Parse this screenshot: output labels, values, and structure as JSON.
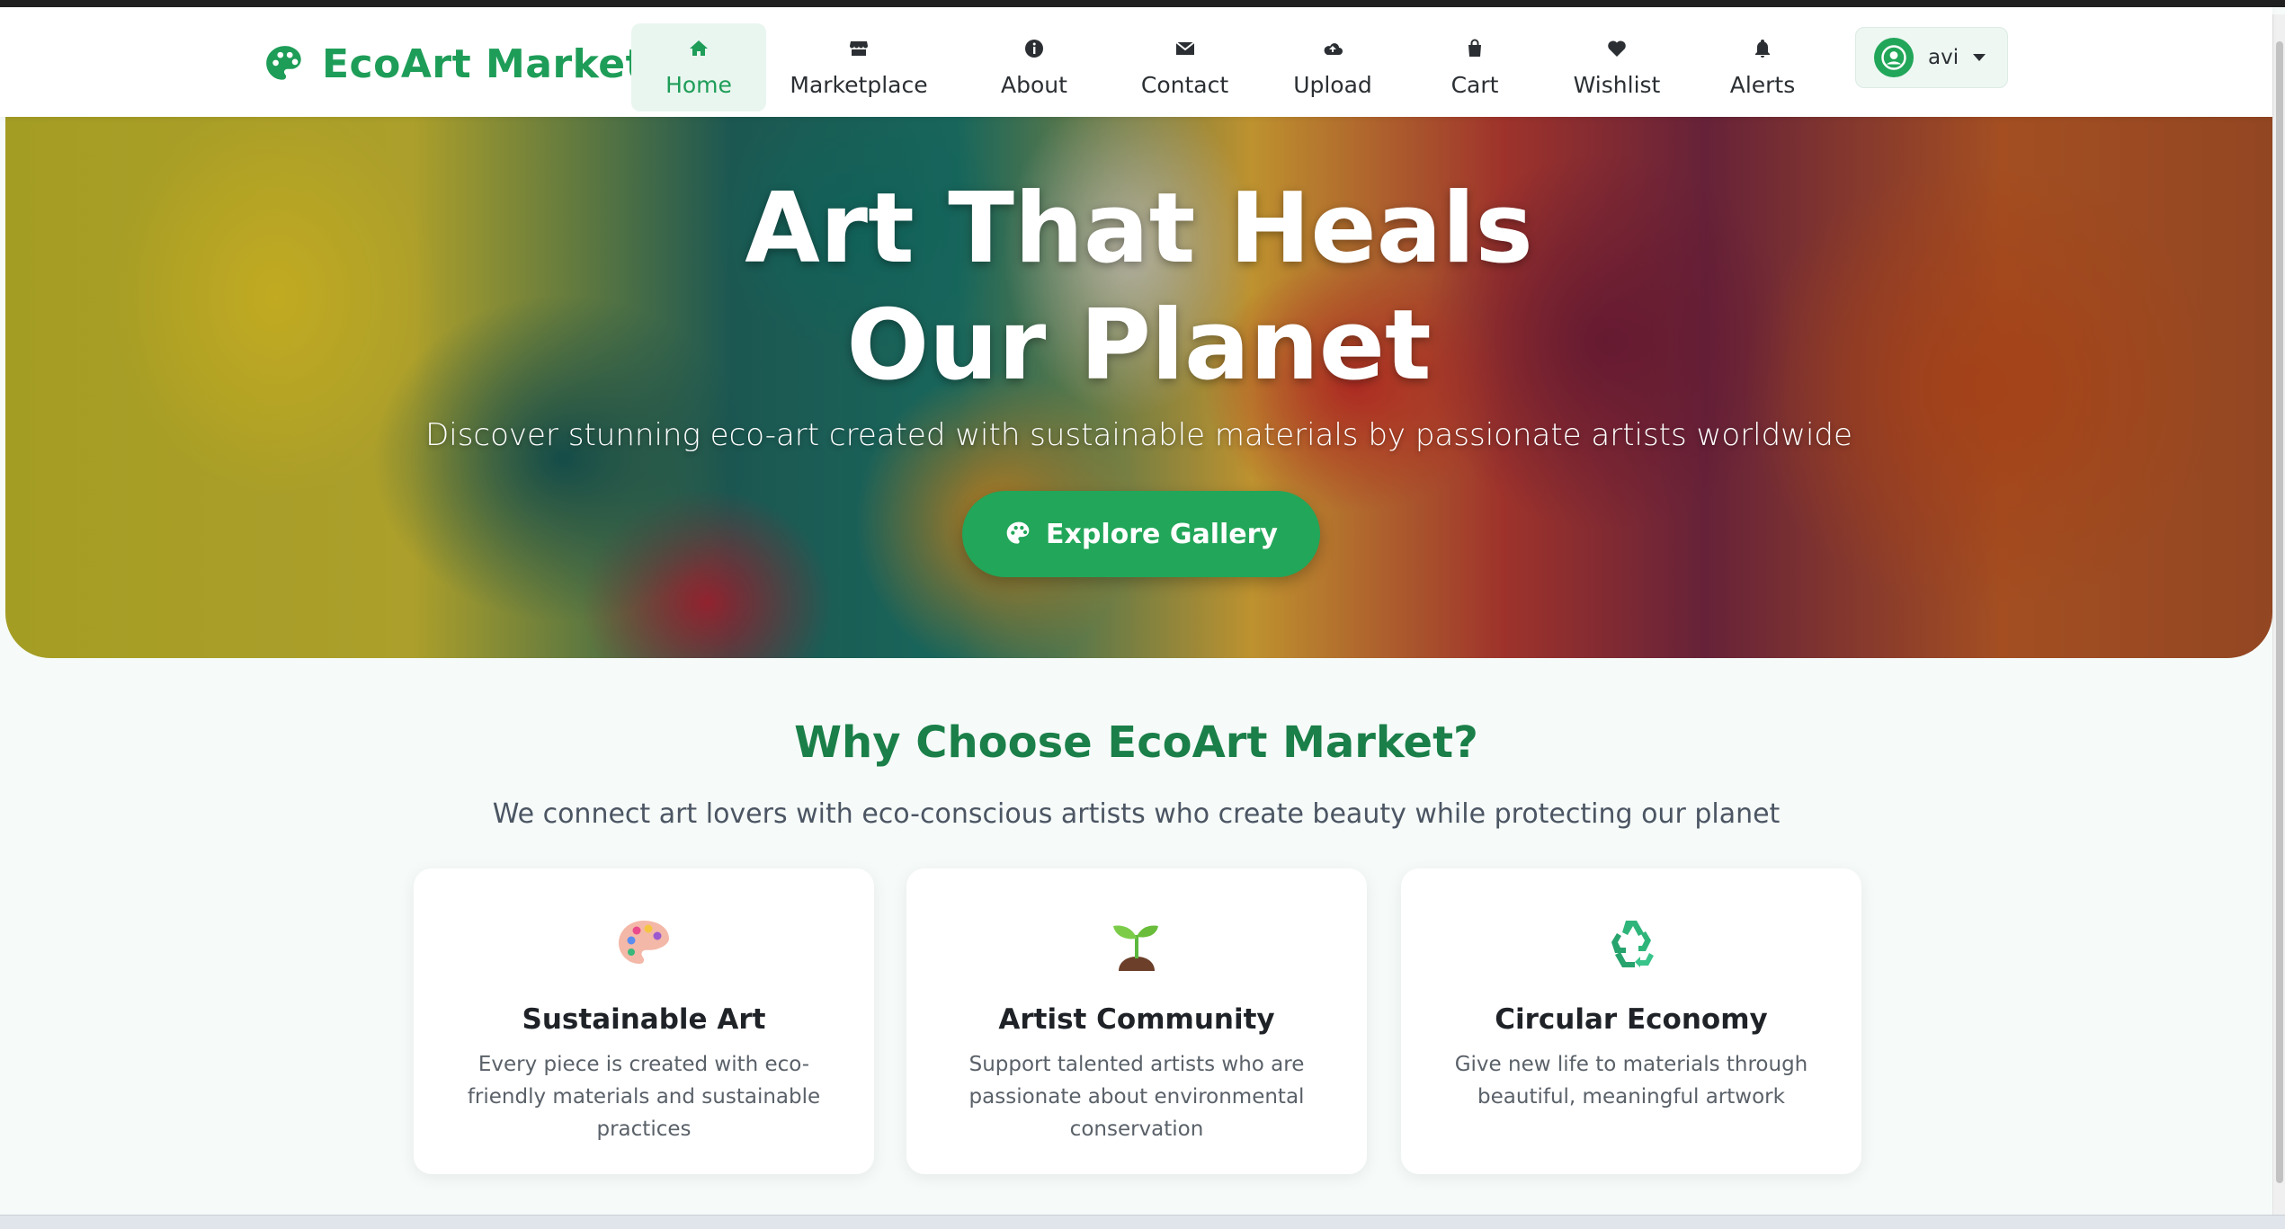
{
  "brand": {
    "name": "EcoArt Market",
    "icon": "palette-icon",
    "color": "#1e9d58"
  },
  "nav": {
    "items": [
      {
        "label": "Home",
        "icon": "home-icon",
        "active": true
      },
      {
        "label": "Marketplace",
        "icon": "store-icon"
      },
      {
        "label": "About",
        "icon": "info-icon"
      },
      {
        "label": "Contact",
        "icon": "envelope-icon"
      },
      {
        "label": "Upload",
        "icon": "cloud-upload-icon"
      },
      {
        "label": "Cart",
        "icon": "bag-icon"
      },
      {
        "label": "Wishlist",
        "icon": "heart-icon"
      },
      {
        "label": "Alerts",
        "icon": "bell-icon"
      }
    ],
    "user": {
      "name": "avi",
      "icon": "user-circle-icon"
    }
  },
  "hero": {
    "title_line1": "Art That Heals",
    "title_line2": "Our Planet",
    "subtitle": "Discover stunning eco-art created with sustainable materials by passionate artists worldwide",
    "button": "Explore Gallery"
  },
  "why": {
    "title": "Why Choose EcoArt Market?",
    "subtitle": "We connect art lovers with eco-conscious artists who create beauty while protecting our planet",
    "cards": [
      {
        "icon": "artist-palette-icon",
        "title": "Sustainable Art",
        "text": "Every piece is created with eco-friendly materials and sustainable practices"
      },
      {
        "icon": "seedling-icon",
        "title": "Artist Community",
        "text": "Support talented artists who are passionate about environmental conservation"
      },
      {
        "icon": "recycle-icon",
        "title": "Circular Economy",
        "text": "Give new life to materials through beautiful, meaningful artwork"
      }
    ]
  },
  "colors": {
    "accent": "#22a659",
    "heading": "#1a7f48"
  }
}
